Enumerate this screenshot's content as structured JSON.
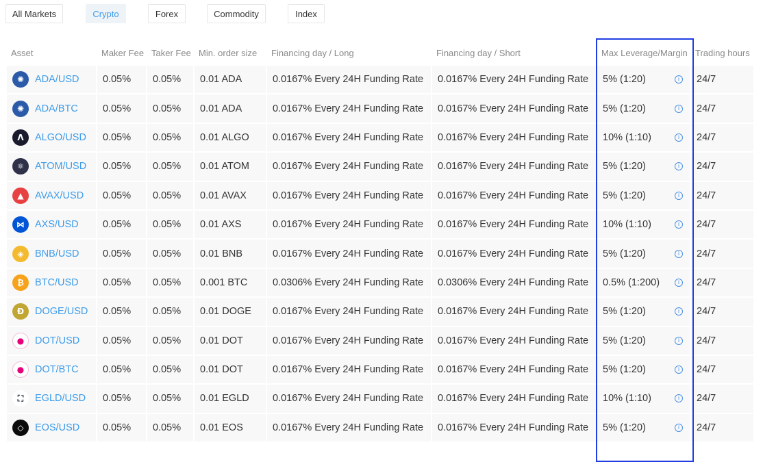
{
  "tabs": [
    {
      "label": "All Markets",
      "active": false
    },
    {
      "label": "Crypto",
      "active": true
    },
    {
      "label": "Forex",
      "active": false
    },
    {
      "label": "Commodity",
      "active": false
    },
    {
      "label": "Index",
      "active": false
    }
  ],
  "columns": [
    "Asset",
    "Maker Fee",
    "Taker Fee",
    "Min. order size",
    "Financing day / Long",
    "Financing day / Short",
    "Max Leverage/Margin",
    "Trading hours"
  ],
  "rows": [
    {
      "asset": "ADA/USD",
      "icon": "cardano-icon",
      "icon_color": "#2a5aa8",
      "maker": "0.05%",
      "taker": "0.05%",
      "min": "0.01 ADA",
      "long": "0.0167% Every 24H Funding Rate",
      "short": "0.0167% Every 24H Funding Rate",
      "leverage": "5% (1:20)",
      "hours": "24/7"
    },
    {
      "asset": "ADA/BTC",
      "icon": "cardano-icon",
      "icon_color": "#2a5aa8",
      "maker": "0.05%",
      "taker": "0.05%",
      "min": "0.01 ADA",
      "long": "0.0167% Every 24H Funding Rate",
      "short": "0.0167% Every 24H Funding Rate",
      "leverage": "5% (1:20)",
      "hours": "24/7"
    },
    {
      "asset": "ALGO/USD",
      "icon": "algorand-icon",
      "icon_color": "#1a1a2e",
      "maker": "0.05%",
      "taker": "0.05%",
      "min": "0.01 ALGO",
      "long": "0.0167% Every 24H Funding Rate",
      "short": "0.0167% Every 24H Funding Rate",
      "leverage": "10% (1:10)",
      "hours": "24/7"
    },
    {
      "asset": "ATOM/USD",
      "icon": "cosmos-icon",
      "icon_color": "#2e3148",
      "maker": "0.05%",
      "taker": "0.05%",
      "min": "0.01 ATOM",
      "long": "0.0167% Every 24H Funding Rate",
      "short": "0.0167% Every 24H Funding Rate",
      "leverage": "5% (1:20)",
      "hours": "24/7"
    },
    {
      "asset": "AVAX/USD",
      "icon": "avalanche-icon",
      "icon_color": "#e84142",
      "maker": "0.05%",
      "taker": "0.05%",
      "min": "0.01 AVAX",
      "long": "0.0167% Every 24H Funding Rate",
      "short": "0.0167% Every 24H Funding Rate",
      "leverage": "5% (1:20)",
      "hours": "24/7"
    },
    {
      "asset": "AXS/USD",
      "icon": "axie-icon",
      "icon_color": "#0055d5",
      "maker": "0.05%",
      "taker": "0.05%",
      "min": "0.01 AXS",
      "long": "0.0167% Every 24H Funding Rate",
      "short": "0.0167% Every 24H Funding Rate",
      "leverage": "10% (1:10)",
      "hours": "24/7"
    },
    {
      "asset": "BNB/USD",
      "icon": "bnb-icon",
      "icon_color": "#f3ba2f",
      "maker": "0.05%",
      "taker": "0.05%",
      "min": "0.01 BNB",
      "long": "0.0167% Every 24H Funding Rate",
      "short": "0.0167% Every 24H Funding Rate",
      "leverage": "5% (1:20)",
      "hours": "24/7"
    },
    {
      "asset": "BTC/USD",
      "icon": "bitcoin-icon",
      "icon_color": "#f7a21b",
      "maker": "0.05%",
      "taker": "0.05%",
      "min": "0.001 BTC",
      "long": "0.0306% Every 24H Funding Rate",
      "short": "0.0306% Every 24H Funding Rate",
      "leverage": "0.5% (1:200)",
      "hours": "24/7"
    },
    {
      "asset": "DOGE/USD",
      "icon": "dogecoin-icon",
      "icon_color": "#c2a633",
      "maker": "0.05%",
      "taker": "0.05%",
      "min": "0.01 DOGE",
      "long": "0.0167% Every 24H Funding Rate",
      "short": "0.0167% Every 24H Funding Rate",
      "leverage": "5% (1:20)",
      "hours": "24/7"
    },
    {
      "asset": "DOT/USD",
      "icon": "polkadot-icon",
      "icon_color": "#e6007a",
      "maker": "0.05%",
      "taker": "0.05%",
      "min": "0.01 DOT",
      "long": "0.0167% Every 24H Funding Rate",
      "short": "0.0167% Every 24H Funding Rate",
      "leverage": "5% (1:20)",
      "hours": "24/7"
    },
    {
      "asset": "DOT/BTC",
      "icon": "polkadot-icon",
      "icon_color": "#e6007a",
      "maker": "0.05%",
      "taker": "0.05%",
      "min": "0.01 DOT",
      "long": "0.0167% Every 24H Funding Rate",
      "short": "0.0167% Every 24H Funding Rate",
      "leverage": "5% (1:20)",
      "hours": "24/7"
    },
    {
      "asset": "EGLD/USD",
      "icon": "elrond-icon",
      "icon_color": "#1b2a3a",
      "maker": "0.05%",
      "taker": "0.05%",
      "min": "0.01 EGLD",
      "long": "0.0167% Every 24H Funding Rate",
      "short": "0.0167% Every 24H Funding Rate",
      "leverage": "10% (1:10)",
      "hours": "24/7"
    },
    {
      "asset": "EOS/USD",
      "icon": "eos-icon",
      "icon_color": "#0b0b0b",
      "maker": "0.05%",
      "taker": "0.05%",
      "min": "0.01 EOS",
      "long": "0.0167% Every 24H Funding Rate",
      "short": "0.0167% Every 24H Funding Rate",
      "leverage": "5% (1:20)",
      "hours": "24/7"
    }
  ],
  "colors": {
    "accent": "#3d9be9",
    "highlight_border": "#1f3de0",
    "row_bg": "#f8f8f8"
  }
}
